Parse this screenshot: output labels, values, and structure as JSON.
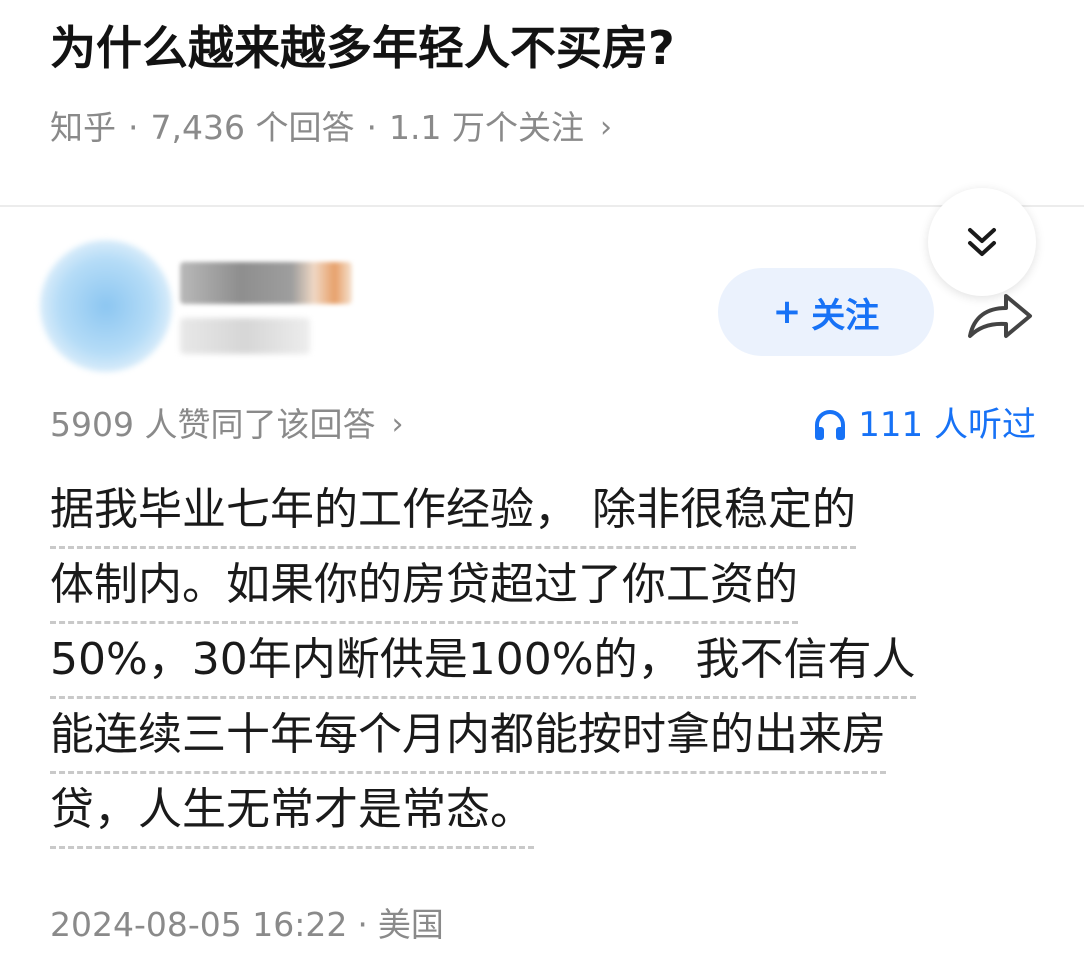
{
  "question": {
    "title": "为什么越来越多年轻人不买房?",
    "source": "知乎",
    "answers_count": "7,436 个回答",
    "followers": "1.1 万个关注",
    "chevron": "›"
  },
  "author": {
    "follow_label": "关注",
    "follow_plus": "+"
  },
  "answer": {
    "upvotes_text": "5909 人赞同了该回答",
    "chevron": "›",
    "listen_text": "111 人听过",
    "lines": [
      "据我毕业七年的工作经验， 除非很稳定的",
      "体制内。如果你的房贷超过了你工资的",
      "50%，30年内断供是100%的， 我不信有人",
      "能连续三十年每个月内都能按时拿的出来房",
      "贷，人生无常才是常态。"
    ],
    "date": "2024-08-05 16:22",
    "location": "美国"
  },
  "icons": {
    "collapse": "double-chevron-down-icon",
    "share": "share-arrow-icon",
    "headphones": "headphones-icon"
  },
  "colors": {
    "accent": "#1772f6",
    "follow_bg": "#ebf2fd",
    "meta_text": "#8a8a8a"
  }
}
